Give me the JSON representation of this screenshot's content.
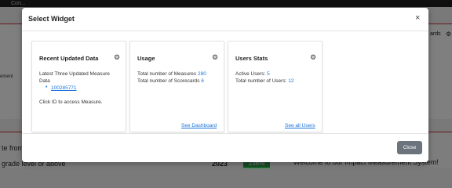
{
  "background": {
    "topbar_text": "Con...",
    "left_snippet": "ement",
    "right_snippet": "ards",
    "row1": "te from",
    "row2": "grade level or above",
    "year": "2023",
    "percent": "236%",
    "welcome": "Welcome to our Impact Measurement System!"
  },
  "modal": {
    "title": "Select Widget",
    "close_symbol": "×",
    "close_button": "Close"
  },
  "cards": [
    {
      "title": "Recent Updated Data",
      "line1": "Latest Three Updated Measure",
      "line2": "Data",
      "item": "100285771",
      "note": "Click ID to access Measure."
    },
    {
      "title": "Usage",
      "measures_label": "Total number of Measures",
      "measures_value": "280",
      "scorecards_label": "Total number of Scorecards",
      "scorecards_value": "6",
      "link": "See Dashboard"
    },
    {
      "title": "Users Stats",
      "active_label": "Active Users:",
      "active_value": "5",
      "total_label": "Total number of Users:",
      "total_value": "12",
      "link": "See all Users"
    }
  ],
  "icons": {
    "gear": "gear-icon",
    "close": "close-icon"
  },
  "colors": {
    "link": "#1a73d9",
    "close_button": "#6c757d",
    "badge": "#2e9e4a"
  }
}
